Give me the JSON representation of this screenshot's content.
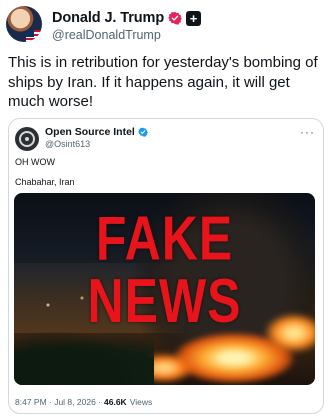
{
  "post": {
    "display_name": "Donald J. Trump",
    "handle": "@realDonaldTrump",
    "plus_badge": "+",
    "text": "This is in retribution for yesterday's bombing of ships by Iran. If it happens again, it will get much worse!",
    "colors": {
      "verified_badge": "#e0245e"
    }
  },
  "quoted": {
    "display_name": "Open Source Intel",
    "handle": "@Osint613",
    "more": "···",
    "line1": "OH WOW",
    "line2": "Chabahar, Iran",
    "overlay_text": "FAKE NEWS",
    "time": "8:47 PM · Jul 8, 2026 ·",
    "views_count": "46.6K",
    "views_label": "Views",
    "colors": {
      "verified_badge": "#1d9bf0",
      "overlay_text": "#e8141b"
    }
  }
}
